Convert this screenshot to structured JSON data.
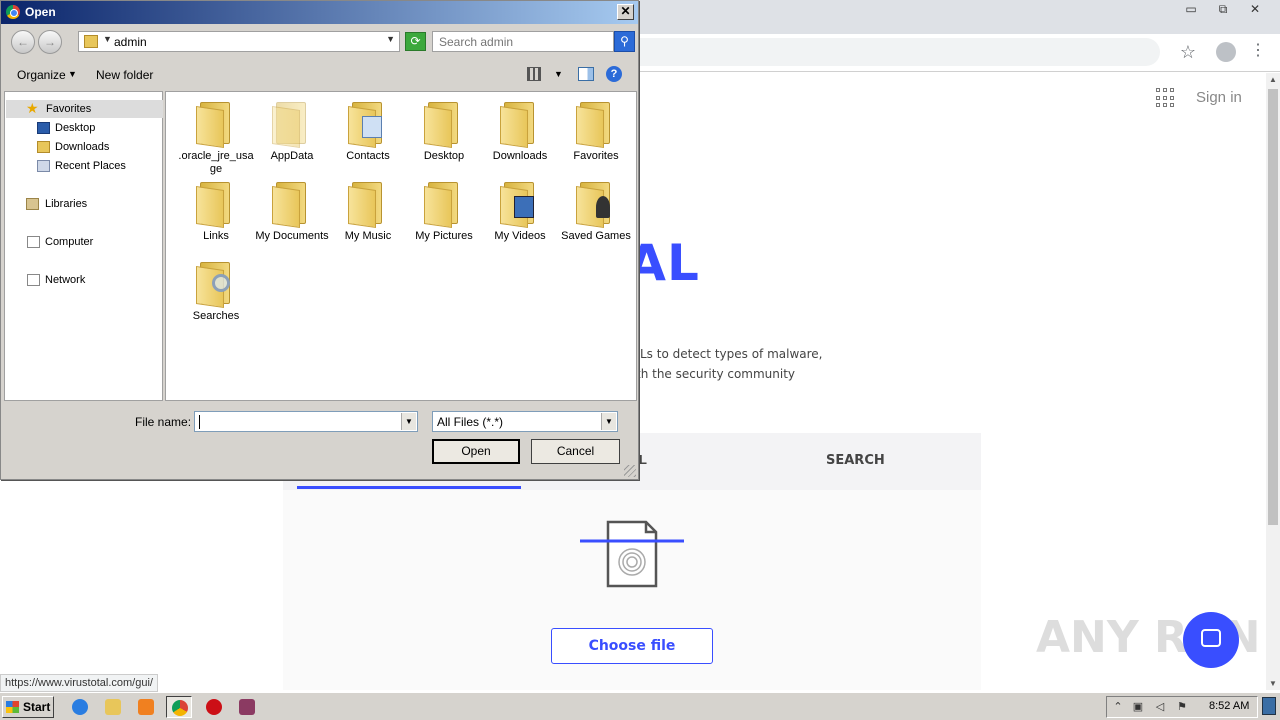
{
  "browser": {
    "window_controls": {
      "minimize": "▭",
      "maximize": "⧉",
      "close": "✕"
    },
    "sign_in": "Sign in",
    "logo_text": "VIRUSTOTAL",
    "desc_line1": "Ls to detect types of malware,",
    "desc_line2": "th the security community",
    "tab_url": "L",
    "tab_search": "SEARCH",
    "choose_file": "Choose file",
    "status_url": "https://www.virustotal.com/gui/",
    "watermark": "ANY RUN",
    "accent": "#394eff"
  },
  "dialog": {
    "title": "Open",
    "close": "✕",
    "back": "←",
    "forward": "→",
    "address": "admin",
    "search_placeholder": "Search admin",
    "organize": "Organize",
    "new_folder": "New folder",
    "help": "?",
    "nav": {
      "favorites": "Favorites",
      "desktop": "Desktop",
      "downloads": "Downloads",
      "recent_places": "Recent Places",
      "libraries": "Libraries",
      "computer": "Computer",
      "network": "Network"
    },
    "files": [
      {
        "name": ".oracle_jre_usage"
      },
      {
        "name": "AppData"
      },
      {
        "name": "Contacts"
      },
      {
        "name": "Desktop"
      },
      {
        "name": "Downloads"
      },
      {
        "name": "Favorites"
      },
      {
        "name": "Links"
      },
      {
        "name": "My Documents"
      },
      {
        "name": "My Music"
      },
      {
        "name": "My Pictures"
      },
      {
        "name": "My Videos"
      },
      {
        "name": "Saved Games"
      },
      {
        "name": "Searches"
      }
    ],
    "file_name_label": "File name:",
    "file_name_value": "",
    "filter": "All Files (*.*)",
    "open_button": "Open",
    "cancel_button": "Cancel"
  },
  "taskbar": {
    "start": "Start",
    "clock": "8:52 AM",
    "items": [
      {
        "icon": "ie-icon",
        "color": "#2a7de1"
      },
      {
        "icon": "explorer-icon",
        "color": "#e8c65a"
      },
      {
        "icon": "media-player-icon",
        "color": "#f08020"
      },
      {
        "icon": "chrome-icon",
        "color": "#db4437"
      },
      {
        "icon": "opera-icon",
        "color": "#cc0f16"
      },
      {
        "icon": "winrar-icon",
        "color": "#8b3a62"
      }
    ]
  }
}
